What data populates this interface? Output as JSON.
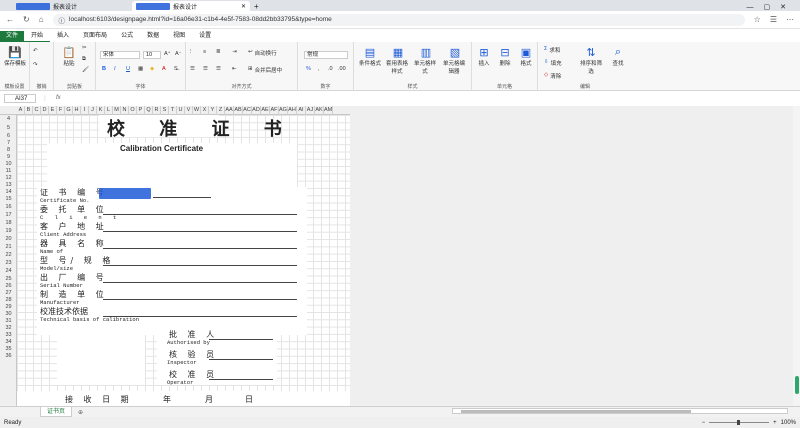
{
  "browser": {
    "tabs": [
      {
        "label": "报表设计"
      },
      {
        "label": "报表设计"
      }
    ],
    "url": "localhost:6103/designpage.html?id=16a06e31-c1b4-4e5f-7583-08dd2bb33795&type=home"
  },
  "menu": {
    "file": "文件",
    "items": [
      "开始",
      "插入",
      "页面布局",
      "公式",
      "数据",
      "视图",
      "设置"
    ]
  },
  "ribbon": {
    "save": "保存模板",
    "template_group": "模板设置",
    "undo_group": "撤销",
    "paste": "粘贴",
    "clipboard_group": "剪贴板",
    "font_name": "宋体",
    "font_size": "10",
    "font_group": "字体",
    "wrap": "自动换行",
    "merge": "合并后居中",
    "align_group": "对齐方式",
    "number_format": "常规",
    "number_group": "数字",
    "cond_format": "条件格式",
    "table_format": "套用表格样式",
    "cell_style": "单元格样式",
    "cell_edit": "单元格编辑器",
    "style_group": "样式",
    "insert": "插入",
    "delete": "删除",
    "format": "格式",
    "cells_group": "单元格",
    "sum": "求和",
    "fill": "填充",
    "clear": "清除",
    "sort": "排序和筛选",
    "find": "查找",
    "edit_group": "编辑"
  },
  "formula_bar": {
    "name_box": "AI37",
    "fx": "fx"
  },
  "columns": [
    "A",
    "B",
    "C",
    "D",
    "E",
    "F",
    "G",
    "H",
    "I",
    "J",
    "K",
    "L",
    "M",
    "N",
    "O",
    "P",
    "Q",
    "R",
    "S",
    "T",
    "U",
    "V",
    "W",
    "X",
    "Y",
    "Z",
    "AA",
    "AB",
    "AC",
    "AD",
    "AE",
    "AF",
    "AG",
    "AH",
    "AI",
    "AJ",
    "AK",
    "AM"
  ],
  "rows": [
    "4",
    "5",
    "6",
    "7",
    "8",
    "9",
    "10",
    "11",
    "12",
    "13",
    "14",
    "15",
    "16",
    "17",
    "18",
    "19",
    "20",
    "21",
    "22",
    "23",
    "24",
    "25",
    "26",
    "27",
    "28",
    "29",
    "30",
    "31",
    "32",
    "33",
    "34",
    "35",
    "36"
  ],
  "certificate": {
    "title": "校 准 证 书",
    "subtitle": "Calibration Certificate",
    "fields": [
      {
        "cn": "证 书 编 号",
        "en": "Certificate No."
      },
      {
        "cn": "委 托 单 位",
        "en": "C l i e n t"
      },
      {
        "cn": "客 户 地 址",
        "en": "Client Address"
      },
      {
        "cn": "器 具 名 称",
        "en": "Name of"
      },
      {
        "cn": "型 号/ 规 格",
        "en": "Model/size"
      },
      {
        "cn": "出 厂 编 号",
        "en": "Serial Number"
      },
      {
        "cn": "制 造 单 位",
        "en": "Manufacturer"
      },
      {
        "cn": "校准技术依据",
        "en": "Technical basis of calibration"
      }
    ],
    "signers": [
      {
        "cn": "批 准 人",
        "en": "Authorised by"
      },
      {
        "cn": "核 验 员",
        "en": "Inspector"
      },
      {
        "cn": "校 准 员",
        "en": "Operator"
      }
    ],
    "receive_date": "接 收 日 期",
    "year": "年",
    "month": "月",
    "day": "日"
  },
  "sheet_tab": "证书页",
  "status": {
    "left": "Ready",
    "zoom": "100%"
  }
}
